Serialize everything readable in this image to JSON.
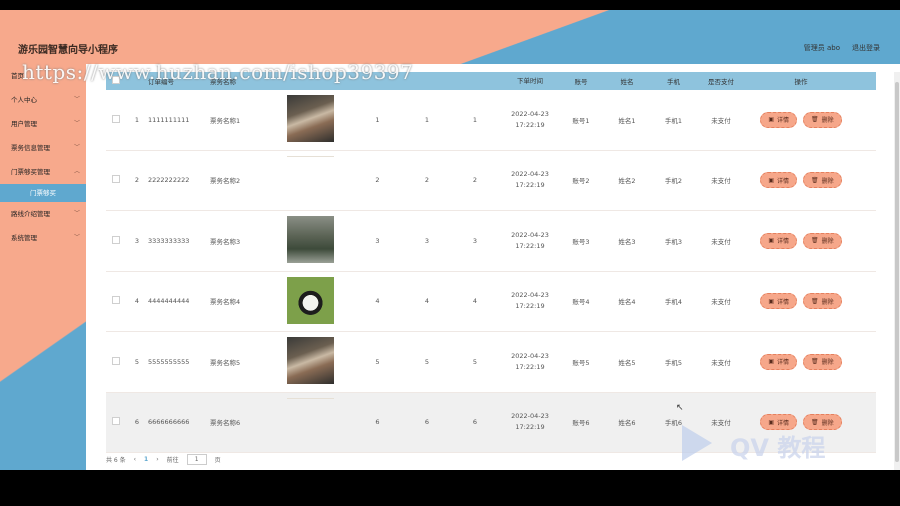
{
  "header": {
    "title": "游乐园智慧向导小程序",
    "user": "管理员 abo",
    "logout": "退出登录"
  },
  "sidebar": {
    "items": [
      {
        "label": "首页"
      },
      {
        "label": "个人中心"
      },
      {
        "label": "用户管理"
      },
      {
        "label": "票务信息管理"
      },
      {
        "label": "门票够买管理"
      }
    ],
    "sub": "门票够买",
    "items2": [
      {
        "label": "路线介绍管理"
      },
      {
        "label": "系统管理"
      }
    ]
  },
  "table": {
    "headers": [
      "订单编号",
      "票务名称",
      "下单时间",
      "账号",
      "姓名",
      "手机",
      "是否支付",
      "操作"
    ],
    "rows": [
      {
        "idx": "1",
        "no": "1111111111",
        "name": "票务名称1",
        "img": "bird",
        "a": "1",
        "b": "1",
        "c": "1",
        "time": "2022-04-23 17:22:19",
        "acc": "账号1",
        "nm": "姓名1",
        "ph": "手机1",
        "pay": "未支付"
      },
      {
        "idx": "2",
        "no": "2222222222",
        "name": "票务名称2",
        "img": "blank",
        "a": "2",
        "b": "2",
        "c": "2",
        "time": "2022-04-23 17:22:19",
        "acc": "账号2",
        "nm": "姓名2",
        "ph": "手机2",
        "pay": "未支付"
      },
      {
        "idx": "3",
        "no": "3333333333",
        "name": "票务名称3",
        "img": "forest",
        "a": "3",
        "b": "3",
        "c": "3",
        "time": "2022-04-23 17:22:19",
        "acc": "账号3",
        "nm": "姓名3",
        "ph": "手机3",
        "pay": "未支付"
      },
      {
        "idx": "4",
        "no": "4444444444",
        "name": "票务名称4",
        "img": "panda",
        "a": "4",
        "b": "4",
        "c": "4",
        "time": "2022-04-23 17:22:19",
        "acc": "账号4",
        "nm": "姓名4",
        "ph": "手机4",
        "pay": "未支付"
      },
      {
        "idx": "5",
        "no": "5555555555",
        "name": "票务名称5",
        "img": "bird",
        "a": "5",
        "b": "5",
        "c": "5",
        "time": "2022-04-23 17:22:19",
        "acc": "账号5",
        "nm": "姓名5",
        "ph": "手机5",
        "pay": "未支付"
      },
      {
        "idx": "6",
        "no": "6666666666",
        "name": "票务名称6",
        "img": "blank",
        "a": "6",
        "b": "6",
        "c": "6",
        "time": "2022-04-23 17:22:19",
        "acc": "账号6",
        "nm": "姓名6",
        "ph": "手机6",
        "pay": "未支付"
      }
    ],
    "detail_label": "详情",
    "delete_label": "删除"
  },
  "pager": {
    "total": "共 6 条",
    "prev": "‹",
    "page": "1",
    "next": "›",
    "goto": "前往",
    "goto_value": "1",
    "unit": "页"
  },
  "watermark": "https://www.huzhan.com/ishop39397",
  "logo_text": "QV 教程",
  "colors": {
    "accent": "#5fa8cf",
    "brand": "#f7a98c",
    "header_row": "#8ec3dd"
  }
}
